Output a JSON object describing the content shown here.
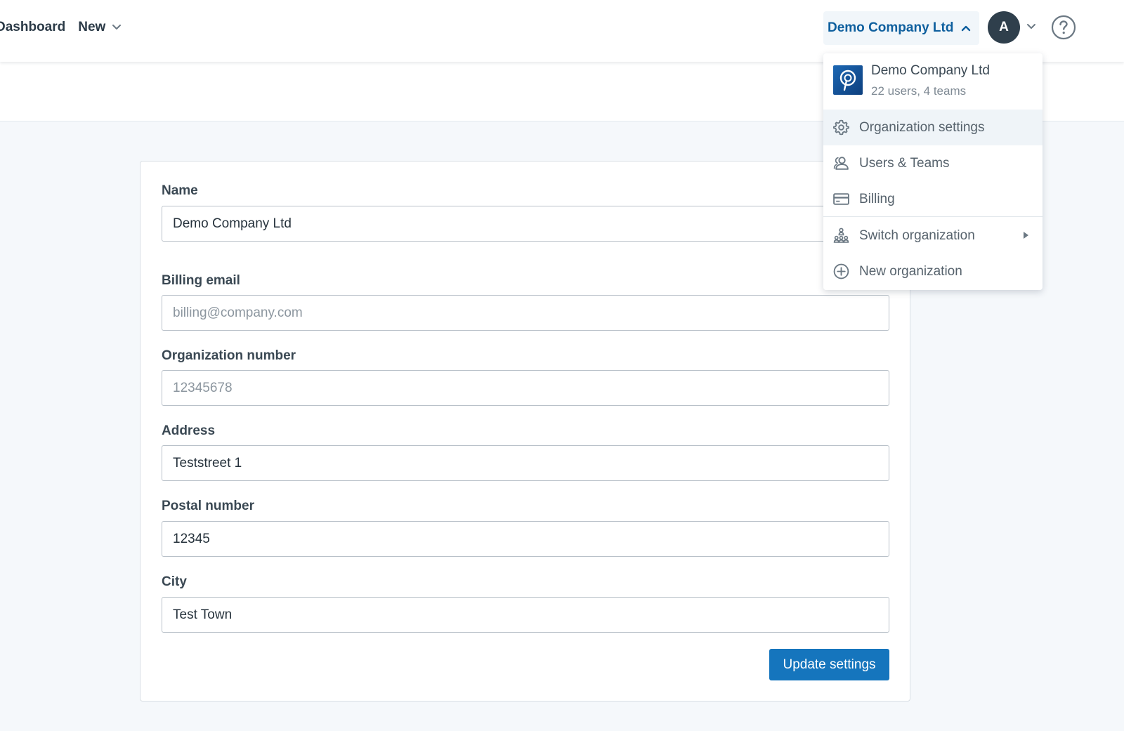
{
  "nav": {
    "dashboard": "Dashboard",
    "new": "New"
  },
  "org_switcher": {
    "label": "Demo Company Ltd"
  },
  "user": {
    "avatar_initial": "A"
  },
  "dropdown": {
    "org_name": "Demo Company Ltd",
    "org_meta": "22 users, 4 teams",
    "items": [
      {
        "label": "Organization settings",
        "icon": "gear-icon"
      },
      {
        "label": "Users & Teams",
        "icon": "users-icon"
      },
      {
        "label": "Billing",
        "icon": "credit-card-icon"
      },
      {
        "label": "Switch organization",
        "icon": "org-tree-icon"
      },
      {
        "label": "New organization",
        "icon": "plus-circle-icon"
      }
    ]
  },
  "form": {
    "name": {
      "label": "Name",
      "value": "Demo Company Ltd",
      "placeholder": ""
    },
    "billing_email": {
      "label": "Billing email",
      "value": "",
      "placeholder": "billing@company.com"
    },
    "org_number": {
      "label": "Organization number",
      "value": "",
      "placeholder": "12345678"
    },
    "address": {
      "label": "Address",
      "value": "Teststreet 1",
      "placeholder": ""
    },
    "postal": {
      "label": "Postal number",
      "value": "12345",
      "placeholder": ""
    },
    "city": {
      "label": "City",
      "value": "Test Town",
      "placeholder": ""
    },
    "submit_label": "Update settings"
  },
  "colors": {
    "primary": "#1575bd",
    "link": "#0e5f9e",
    "avatar_bg": "#2f3f4c",
    "page_bg": "#f5f8fb"
  }
}
